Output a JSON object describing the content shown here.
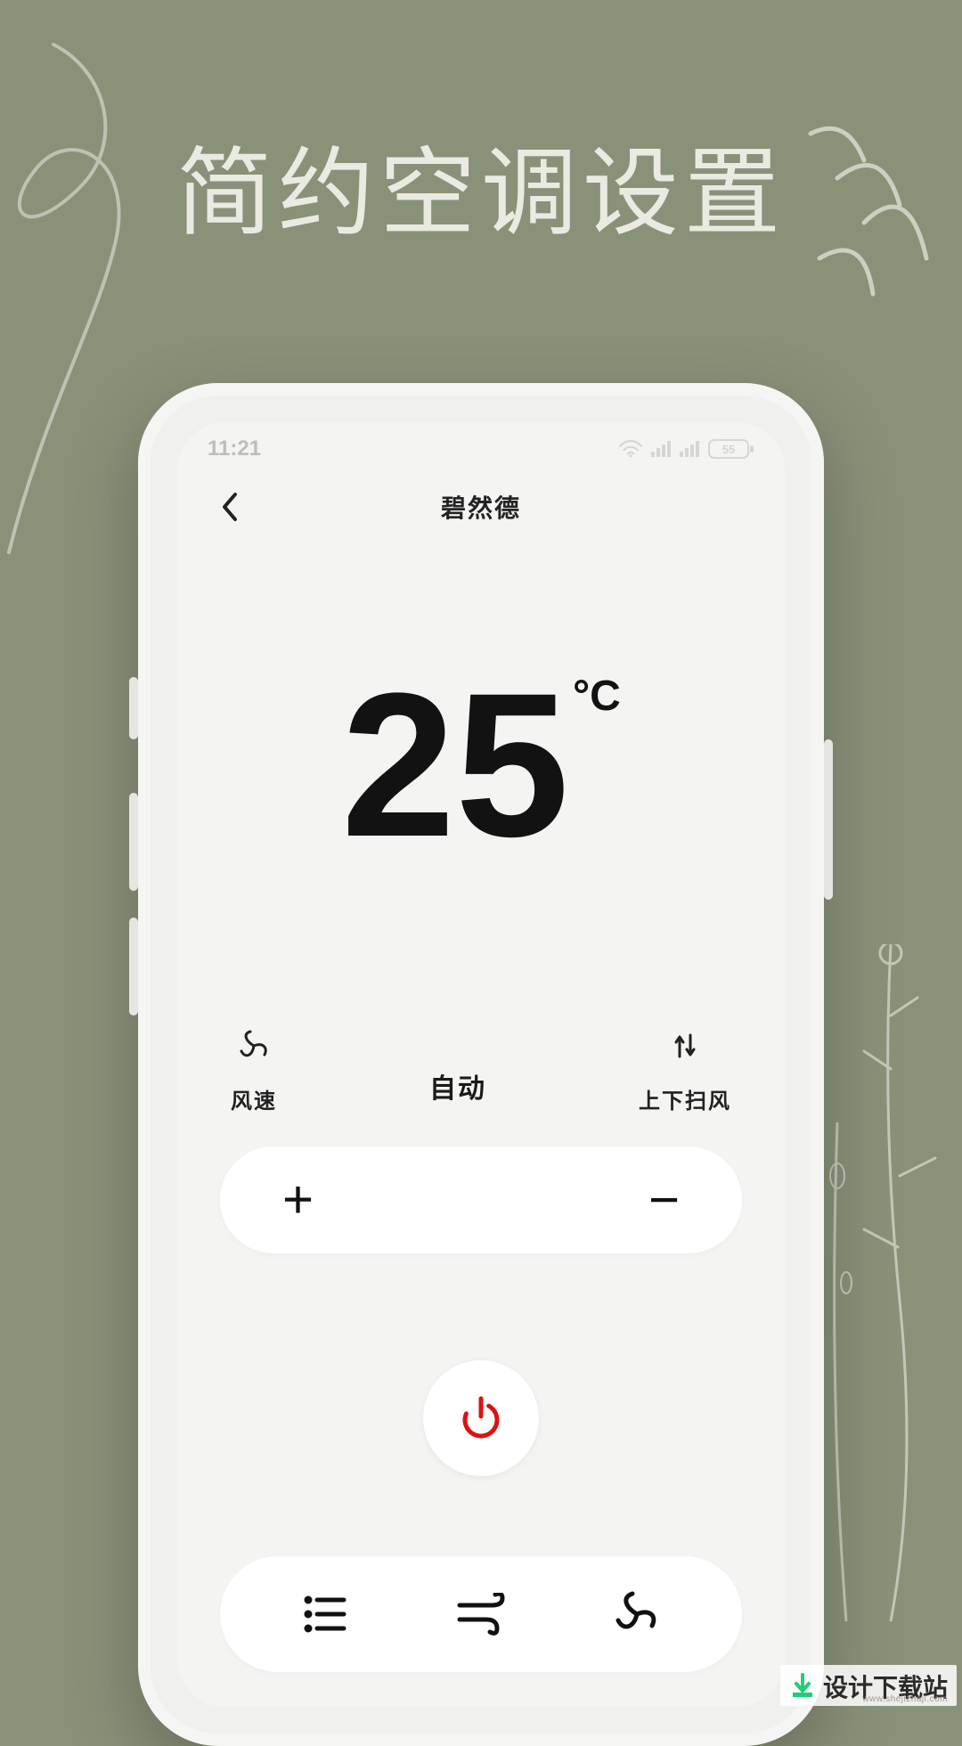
{
  "headline": "简约空调设置",
  "status_bar": {
    "time": "11:21",
    "battery_text": "55"
  },
  "nav": {
    "title": "碧然德"
  },
  "temperature": {
    "value": "25",
    "unit": "°C"
  },
  "mode_row": {
    "left_label": "风速",
    "center_label": "自动",
    "right_label": "上下扫风"
  },
  "adjust": {
    "plus": "+",
    "minus": "−"
  },
  "watermark": {
    "text": "设计下载站",
    "sub": "www.shejizhaji.com"
  }
}
